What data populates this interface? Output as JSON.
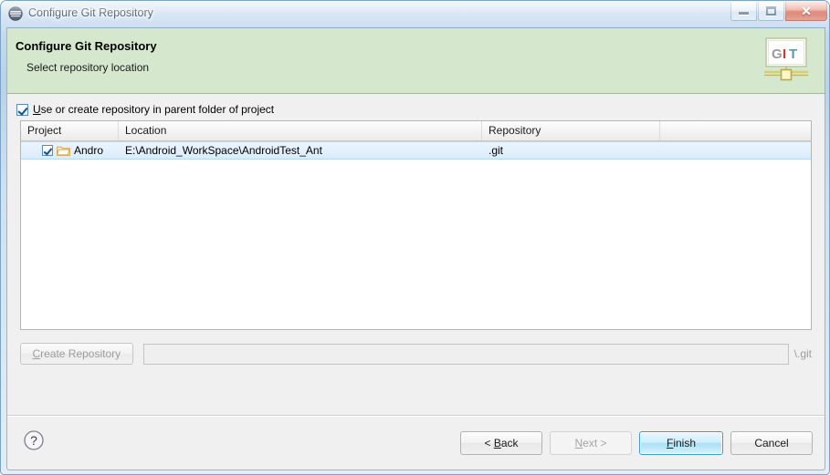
{
  "window": {
    "title": "Configure Git Repository",
    "icon": "eclipse-circle-icon",
    "controls": {
      "minimize": "minimize-button",
      "maximize": "maximize-button",
      "close_glyph": "✕"
    }
  },
  "banner": {
    "title": "Configure Git Repository",
    "subtitle": "Select repository location",
    "logo_text_g": "G",
    "logo_text_i": "I",
    "logo_text_t": "T",
    "background_color": "#d5e8ce"
  },
  "options": {
    "use_parent_label_mnemonic": "U",
    "use_parent_label_rest": "se or create repository in parent folder of project",
    "use_parent_checked": true
  },
  "table": {
    "columns": [
      {
        "label": "Project"
      },
      {
        "label": "Location"
      },
      {
        "label": "Repository"
      },
      {
        "label": ""
      }
    ],
    "rows": [
      {
        "checked": true,
        "project": "Andro",
        "location": "E:\\Android_WorkSpace\\AndroidTest_Ant",
        "repository": ".git",
        "selected": true
      }
    ],
    "selection_color": "#dcecfb"
  },
  "create_repository": {
    "button_mnemonic": "C",
    "button_rest": "reate Repository",
    "button_enabled": false,
    "path_value": "",
    "path_placeholder": "",
    "path_enabled": false,
    "suffix": "\\.git"
  },
  "footer": {
    "help_glyph": "?",
    "buttons": [
      {
        "prefix": "< ",
        "mnemonic": "B",
        "rest": "ack",
        "suffix": "",
        "state": "enabled",
        "name": "back-button"
      },
      {
        "prefix": "",
        "mnemonic": "N",
        "rest": "ext",
        "suffix": " >",
        "state": "disabled",
        "name": "next-button"
      },
      {
        "prefix": "",
        "mnemonic": "F",
        "rest": "inish",
        "suffix": "",
        "state": "default",
        "name": "finish-button"
      },
      {
        "prefix": "",
        "mnemonic": "",
        "rest": "Cancel",
        "suffix": "",
        "state": "enabled",
        "name": "cancel-button"
      }
    ]
  }
}
